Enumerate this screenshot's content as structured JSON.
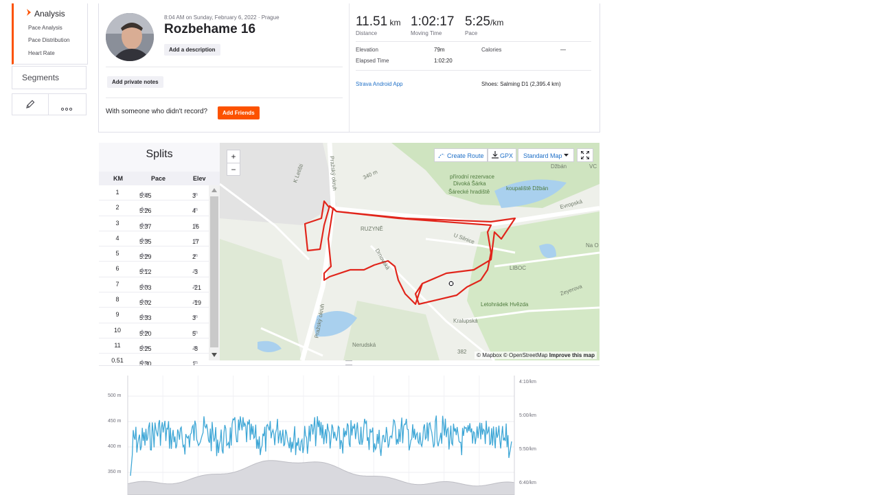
{
  "sidebar": {
    "analysis": "Analysis",
    "items": [
      "Pace Analysis",
      "Pace Distribution",
      "Heart Rate"
    ],
    "segments": "Segments"
  },
  "activity": {
    "meta": "8:04 AM on Sunday, February 6, 2022 · Prague",
    "title": "Rozbehame 16",
    "add_description": "Add a description",
    "add_private_notes": "Add private notes",
    "friends_question": "With someone who didn't record?",
    "add_friends": "Add Friends"
  },
  "stats": {
    "distance": {
      "value": "11.51",
      "unit": "km",
      "label": "Distance"
    },
    "moving_time": {
      "value": "1:02:17",
      "label": "Moving Time"
    },
    "pace": {
      "value": "5:25",
      "unit": "/km",
      "label": "Pace"
    },
    "elevation_label": "Elevation",
    "elevation_value": "79m",
    "calories_label": "Calories",
    "calories_value": "—",
    "elapsed_label": "Elapsed Time",
    "elapsed_value": "1:02:20",
    "device": "Strava Android App",
    "shoes": "Shoes: Salming D1 (2,395.4 km)"
  },
  "splits": {
    "title": "Splits",
    "headers": {
      "km": "KM",
      "pace": "Pace",
      "elev": "Elev"
    },
    "pace_unit": "/km",
    "elev_unit": "m",
    "rows": [
      {
        "km": "1",
        "pace": "5:45",
        "elev": "3"
      },
      {
        "km": "2",
        "pace": "5:26",
        "elev": "4"
      },
      {
        "km": "3",
        "pace": "5:37",
        "elev": "16"
      },
      {
        "km": "4",
        "pace": "5:35",
        "elev": "17"
      },
      {
        "km": "5",
        "pace": "5:29",
        "elev": "2"
      },
      {
        "km": "6",
        "pace": "5:12",
        "elev": "-3"
      },
      {
        "km": "7",
        "pace": "5:03",
        "elev": "-21"
      },
      {
        "km": "8",
        "pace": "5:02",
        "elev": "-19"
      },
      {
        "km": "9",
        "pace": "5:33",
        "elev": "3"
      },
      {
        "km": "10",
        "pace": "5:20",
        "elev": "5"
      },
      {
        "km": "11",
        "pace": "5:25",
        "elev": "-8"
      },
      {
        "km": "0.51",
        "pace": "5:30",
        "elev": "1"
      }
    ]
  },
  "map": {
    "create_route": "Create Route",
    "gpx": "GPX",
    "map_type": "Standard Map",
    "zoom_in": "+",
    "zoom_out": "−",
    "attribution": "© Mapbox © OpenStreetMap",
    "improve": "Improve this map",
    "labels": {
      "reserve1": "přírodní rezervace",
      "reserve2": "Divoká Šárka",
      "reserve3": "Šárecké hradiště",
      "pool": "koupaliště Džbán",
      "dzban": "Džbán",
      "evropska": "Evropská",
      "ruzyne": "RUZYNĚ",
      "liboc": "LIBOC",
      "hvezda": "Letohrádek Hvězda",
      "u_silnice": "U Silnice",
      "k_letisti": "K Letišti",
      "prazsky1": "Pražský okruh",
      "prazsky2": "Pražský okruh",
      "drnovska": "Drnovská",
      "kralupska": "Kralupská",
      "nerudska": "Nerudská",
      "zeyerova": "Zeyerova",
      "alt382": "382",
      "alt340": "340 m",
      "vc": "VC",
      "nao": "Na O"
    }
  },
  "chart_data": {
    "type": "line",
    "y_left_ticks": [
      "500 m",
      "450 m",
      "400 m",
      "350 m"
    ],
    "y_right_ticks": [
      "4:10/km",
      "5:00/km",
      "5:50/km",
      "6:40/km"
    ],
    "series": []
  }
}
